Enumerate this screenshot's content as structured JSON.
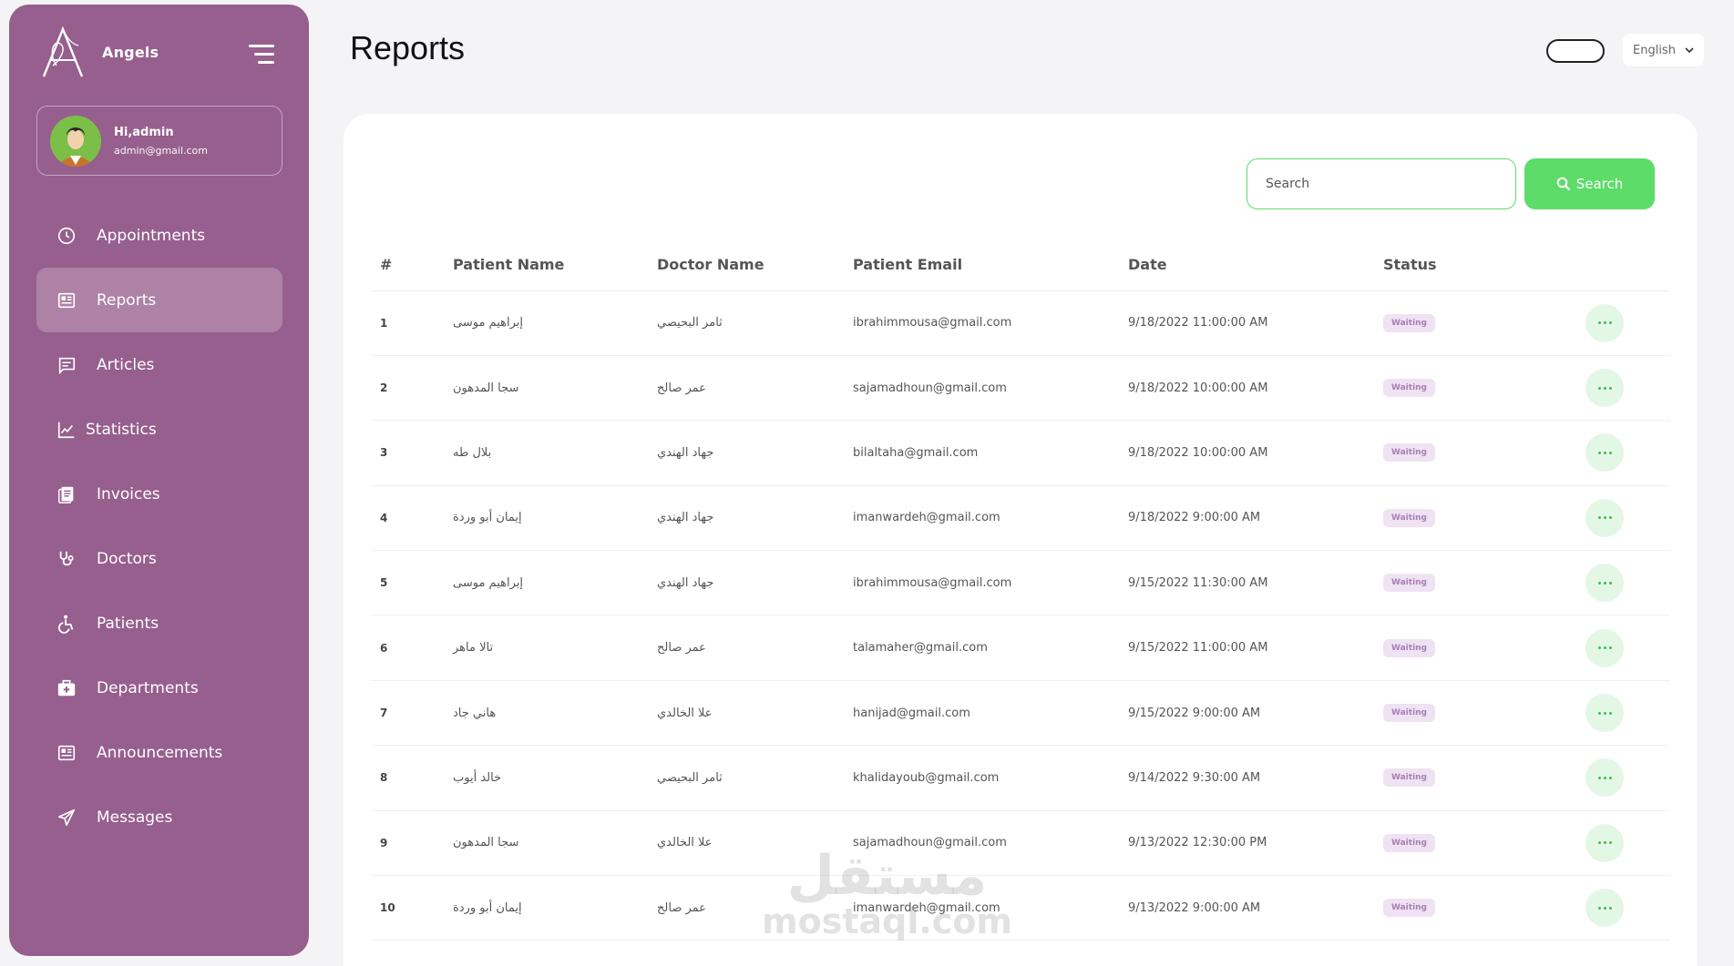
{
  "brand": {
    "name": "Angels"
  },
  "user": {
    "greeting": "Hi,",
    "name": "admin",
    "email": "admin@gmail.com"
  },
  "nav": [
    {
      "label": "Appointments",
      "icon": "clock-icon"
    },
    {
      "label": "Reports",
      "icon": "report-icon",
      "active": true
    },
    {
      "label": "Articles",
      "icon": "articles-icon"
    },
    {
      "label": "Statistics",
      "icon": "chart-line-icon"
    },
    {
      "label": "Invoices",
      "icon": "invoice-icon"
    },
    {
      "label": "Doctors",
      "icon": "stethoscope-icon"
    },
    {
      "label": "Patients",
      "icon": "wheelchair-icon"
    },
    {
      "label": "Departments",
      "icon": "first-aid-kit-icon"
    },
    {
      "label": "Announcements",
      "icon": "newspaper-icon"
    },
    {
      "label": "Messages",
      "icon": "paper-plane-icon"
    }
  ],
  "header": {
    "title": "Reports",
    "language": "English"
  },
  "search": {
    "placeholder": "Search",
    "button_label": "Search"
  },
  "table": {
    "headers": [
      "#",
      "Patient Name",
      "Doctor Name",
      "Patient Email",
      "Date",
      "Status"
    ],
    "rows": [
      {
        "num": "1",
        "patient": "إبراهيم موسى",
        "doctor": "ثامر البحيصي",
        "email": "ibrahimmousa@gmail.com",
        "date": "9/18/2022 11:00:00 AM",
        "status": "Waiting"
      },
      {
        "num": "2",
        "patient": "سجا المدهون",
        "doctor": "عمر صالح",
        "email": "sajamadhoun@gmail.com",
        "date": "9/18/2022 10:00:00 AM",
        "status": "Waiting"
      },
      {
        "num": "3",
        "patient": "بلال طه",
        "doctor": "جهاد الهندي",
        "email": "bilaltaha@gmail.com",
        "date": "9/18/2022 10:00:00 AM",
        "status": "Waiting"
      },
      {
        "num": "4",
        "patient": "إيمان أبو وردة",
        "doctor": "جهاد الهندي",
        "email": "imanwardeh@gmail.com",
        "date": "9/18/2022 9:00:00 AM",
        "status": "Waiting"
      },
      {
        "num": "5",
        "patient": "إبراهيم موسى",
        "doctor": "جهاد الهندي",
        "email": "ibrahimmousa@gmail.com",
        "date": "9/15/2022 11:30:00 AM",
        "status": "Waiting"
      },
      {
        "num": "6",
        "patient": "تالا ماهر",
        "doctor": "عمر صالح",
        "email": "talamaher@gmail.com",
        "date": "9/15/2022 11:00:00 AM",
        "status": "Waiting"
      },
      {
        "num": "7",
        "patient": "هاني جاد",
        "doctor": "علا الخالدي",
        "email": "hanijad@gmail.com",
        "date": "9/15/2022 9:00:00 AM",
        "status": "Waiting"
      },
      {
        "num": "8",
        "patient": "خالد أيوب",
        "doctor": "ثامر البحيصي",
        "email": "khalidayoub@gmail.com",
        "date": "9/14/2022 9:30:00 AM",
        "status": "Waiting"
      },
      {
        "num": "9",
        "patient": "سجا المدهون",
        "doctor": "علا الخالدي",
        "email": "sajamadhoun@gmail.com",
        "date": "9/13/2022 12:30:00 PM",
        "status": "Waiting"
      },
      {
        "num": "10",
        "patient": "إيمان أبو وردة",
        "doctor": "عمر صالح",
        "email": "imanwardeh@gmail.com",
        "date": "9/13/2022 9:00:00 AM",
        "status": "Waiting"
      }
    ]
  },
  "watermark": {
    "arabic": "مستقل",
    "latin": "mostaql.com"
  },
  "colors": {
    "sidebar": "#965f8e",
    "accent_green": "#5ddc6a",
    "badge_bg": "#efe2f2",
    "badge_text": "#a880b4"
  }
}
